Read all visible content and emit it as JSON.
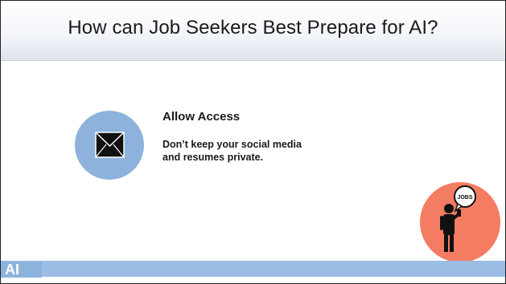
{
  "slide": {
    "title": "How can Job Seekers Best Prepare for AI?",
    "heading": "Allow Access",
    "body": "Don’t keep your social media and resumes private."
  },
  "icons": {
    "mail": "envelope-icon",
    "jobs_badge_text": "JOBS",
    "jobs": "job-seeker-with-phone-icon"
  },
  "footer": {
    "logo_text": "AI"
  },
  "colors": {
    "mail_circle": "#8db3dc",
    "jobs_circle": "#f47c62",
    "footer_bar": "#9cbde4"
  }
}
